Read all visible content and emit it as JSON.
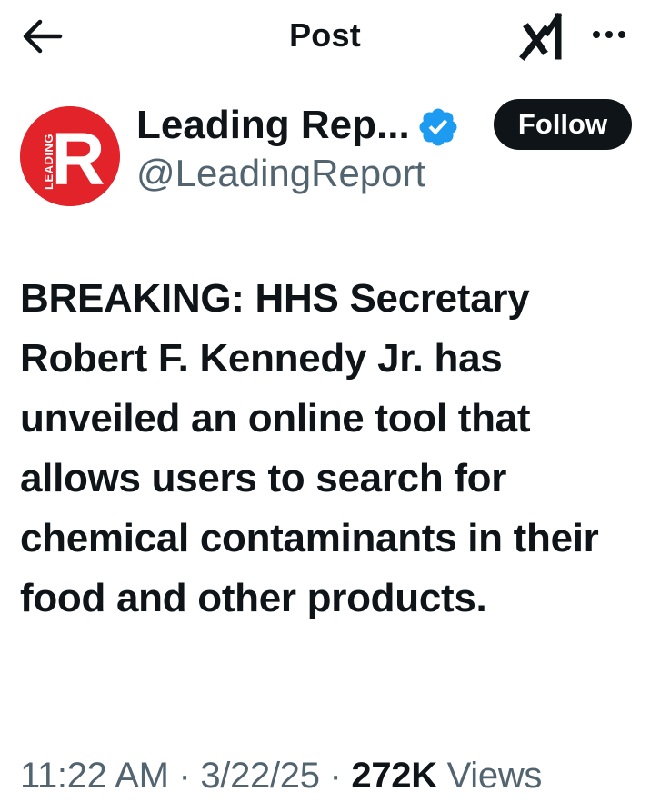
{
  "header": {
    "title": "Post"
  },
  "icons": {
    "back": "arrow-left-icon",
    "grok": "grok-icon",
    "more": "more-horizontal-icon",
    "verified": "verified-badge-icon"
  },
  "author": {
    "display_name": "Leading Rep...",
    "handle": "@LeadingReport",
    "verified": true,
    "avatar": {
      "letter": "R",
      "side_text": "LEADING",
      "bg_color": "#e2232a"
    }
  },
  "follow_button": {
    "label": "Follow"
  },
  "post": {
    "text": "BREAKING: HHS Secretary Robert F. Kennedy Jr. has unveiled an online tool that allows users to search for chemical contaminants in their food and other products.",
    "time": "11:22 AM",
    "separator": "·",
    "date": "3/22/25",
    "views_count": "272K",
    "views_label": "Views"
  },
  "colors": {
    "text_primary": "#0f1419",
    "text_secondary": "#536471",
    "verified_blue": "#1d9bf0",
    "follow_bg": "#0f1419",
    "avatar_red": "#e2232a"
  }
}
